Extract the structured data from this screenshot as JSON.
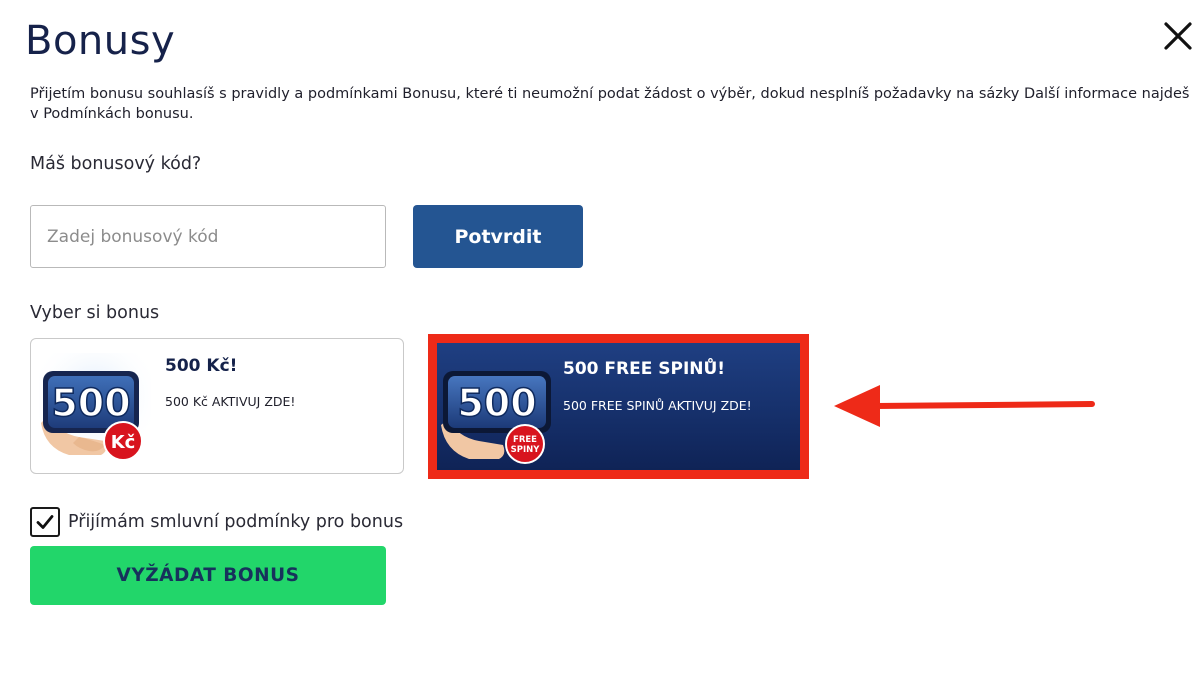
{
  "header": {
    "title": "Bonusy",
    "close_icon": "close-icon"
  },
  "intro_text": "Přijetím bonusu souhlasíš s pravidly a podmínkami Bonusu, které ti neumožní podat žádost o výběr, dokud nesplníš požadavky na sázky Další informace najdeš v Podmínkách bonusu.",
  "code_section": {
    "label": "Máš bonusový kód?",
    "input_value": "",
    "input_placeholder": "Zadej bonusový kód",
    "confirm_label": "Potvrdit"
  },
  "bonus_section": {
    "label": "Vyber si bonus",
    "options": [
      {
        "title": "500 Kč!",
        "description": "500 Kč AKTIVUJ ZDE!",
        "image_number": "500",
        "image_badge": "Kč",
        "selected": false
      },
      {
        "title": "500 FREE SPINŮ!",
        "description": "500 FREE SPINŮ AKTIVUJ ZDE!",
        "image_number": "500",
        "image_badge_line1": "FREE",
        "image_badge_line2": "SPINY",
        "selected": true,
        "highlight_color": "#ee2a18"
      }
    ]
  },
  "annotation_arrow_color": "#ee2a18",
  "terms": {
    "checked": true,
    "label": "Přijímám smluvní podmínky pro bonus"
  },
  "claim_button": {
    "label": "VYŽÁDAT BONUS",
    "color": "#22d66a"
  },
  "colors": {
    "primary_button": "#245592",
    "title": "#16224a",
    "spins_card_bg": "#16306b",
    "badge_red": "#d8141e"
  }
}
